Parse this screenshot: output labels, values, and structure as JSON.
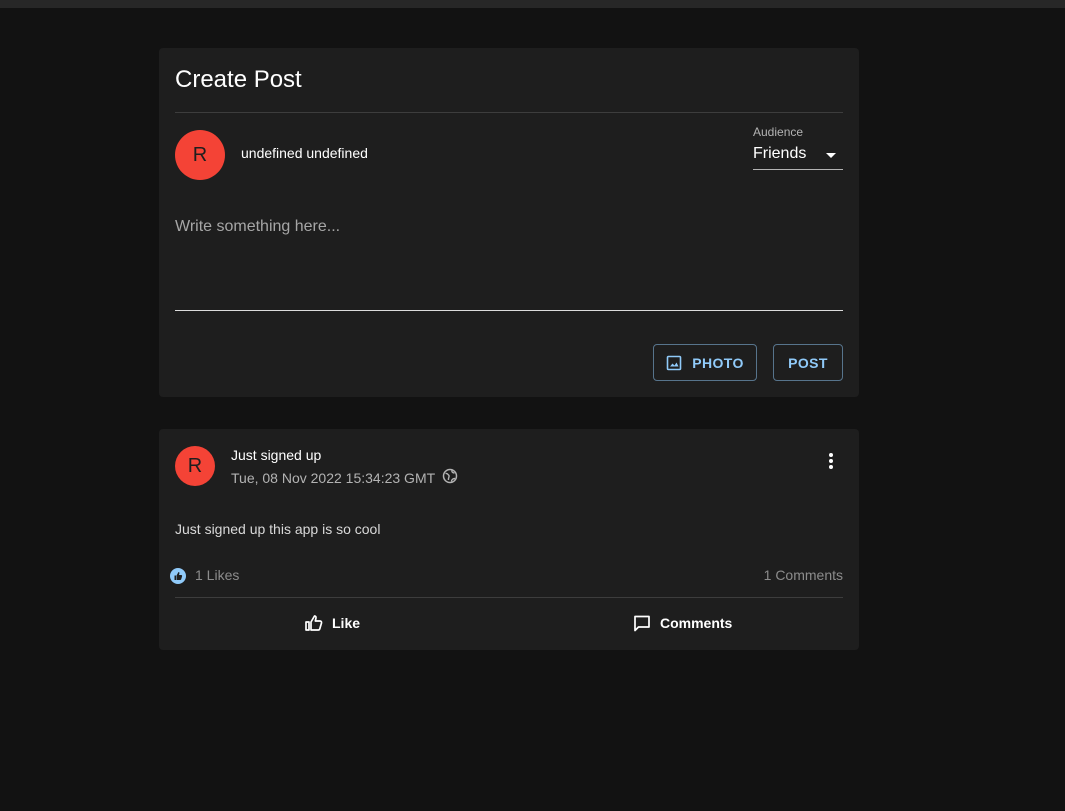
{
  "create_post": {
    "title": "Create Post",
    "avatar_initial": "R",
    "username": "undefined undefined",
    "audience": {
      "label": "Audience",
      "value": "Friends"
    },
    "input": {
      "placeholder": "Write something here..."
    },
    "photo_button": "PHOTO",
    "post_button": "POST"
  },
  "post": {
    "avatar_initial": "R",
    "title": "Just signed up",
    "timestamp": "Tue, 08 Nov 2022 15:34:23 GMT",
    "visibility_icon": "globe-icon",
    "body": "Just signed up this app is so cool",
    "likes": "1 Likes",
    "comments": "1 Comments",
    "like_button": "Like",
    "comments_button": "Comments"
  },
  "colors": {
    "background": "#121212",
    "card": "#1e1e1e",
    "accent": "#90caf9",
    "avatar": "#f44336"
  }
}
